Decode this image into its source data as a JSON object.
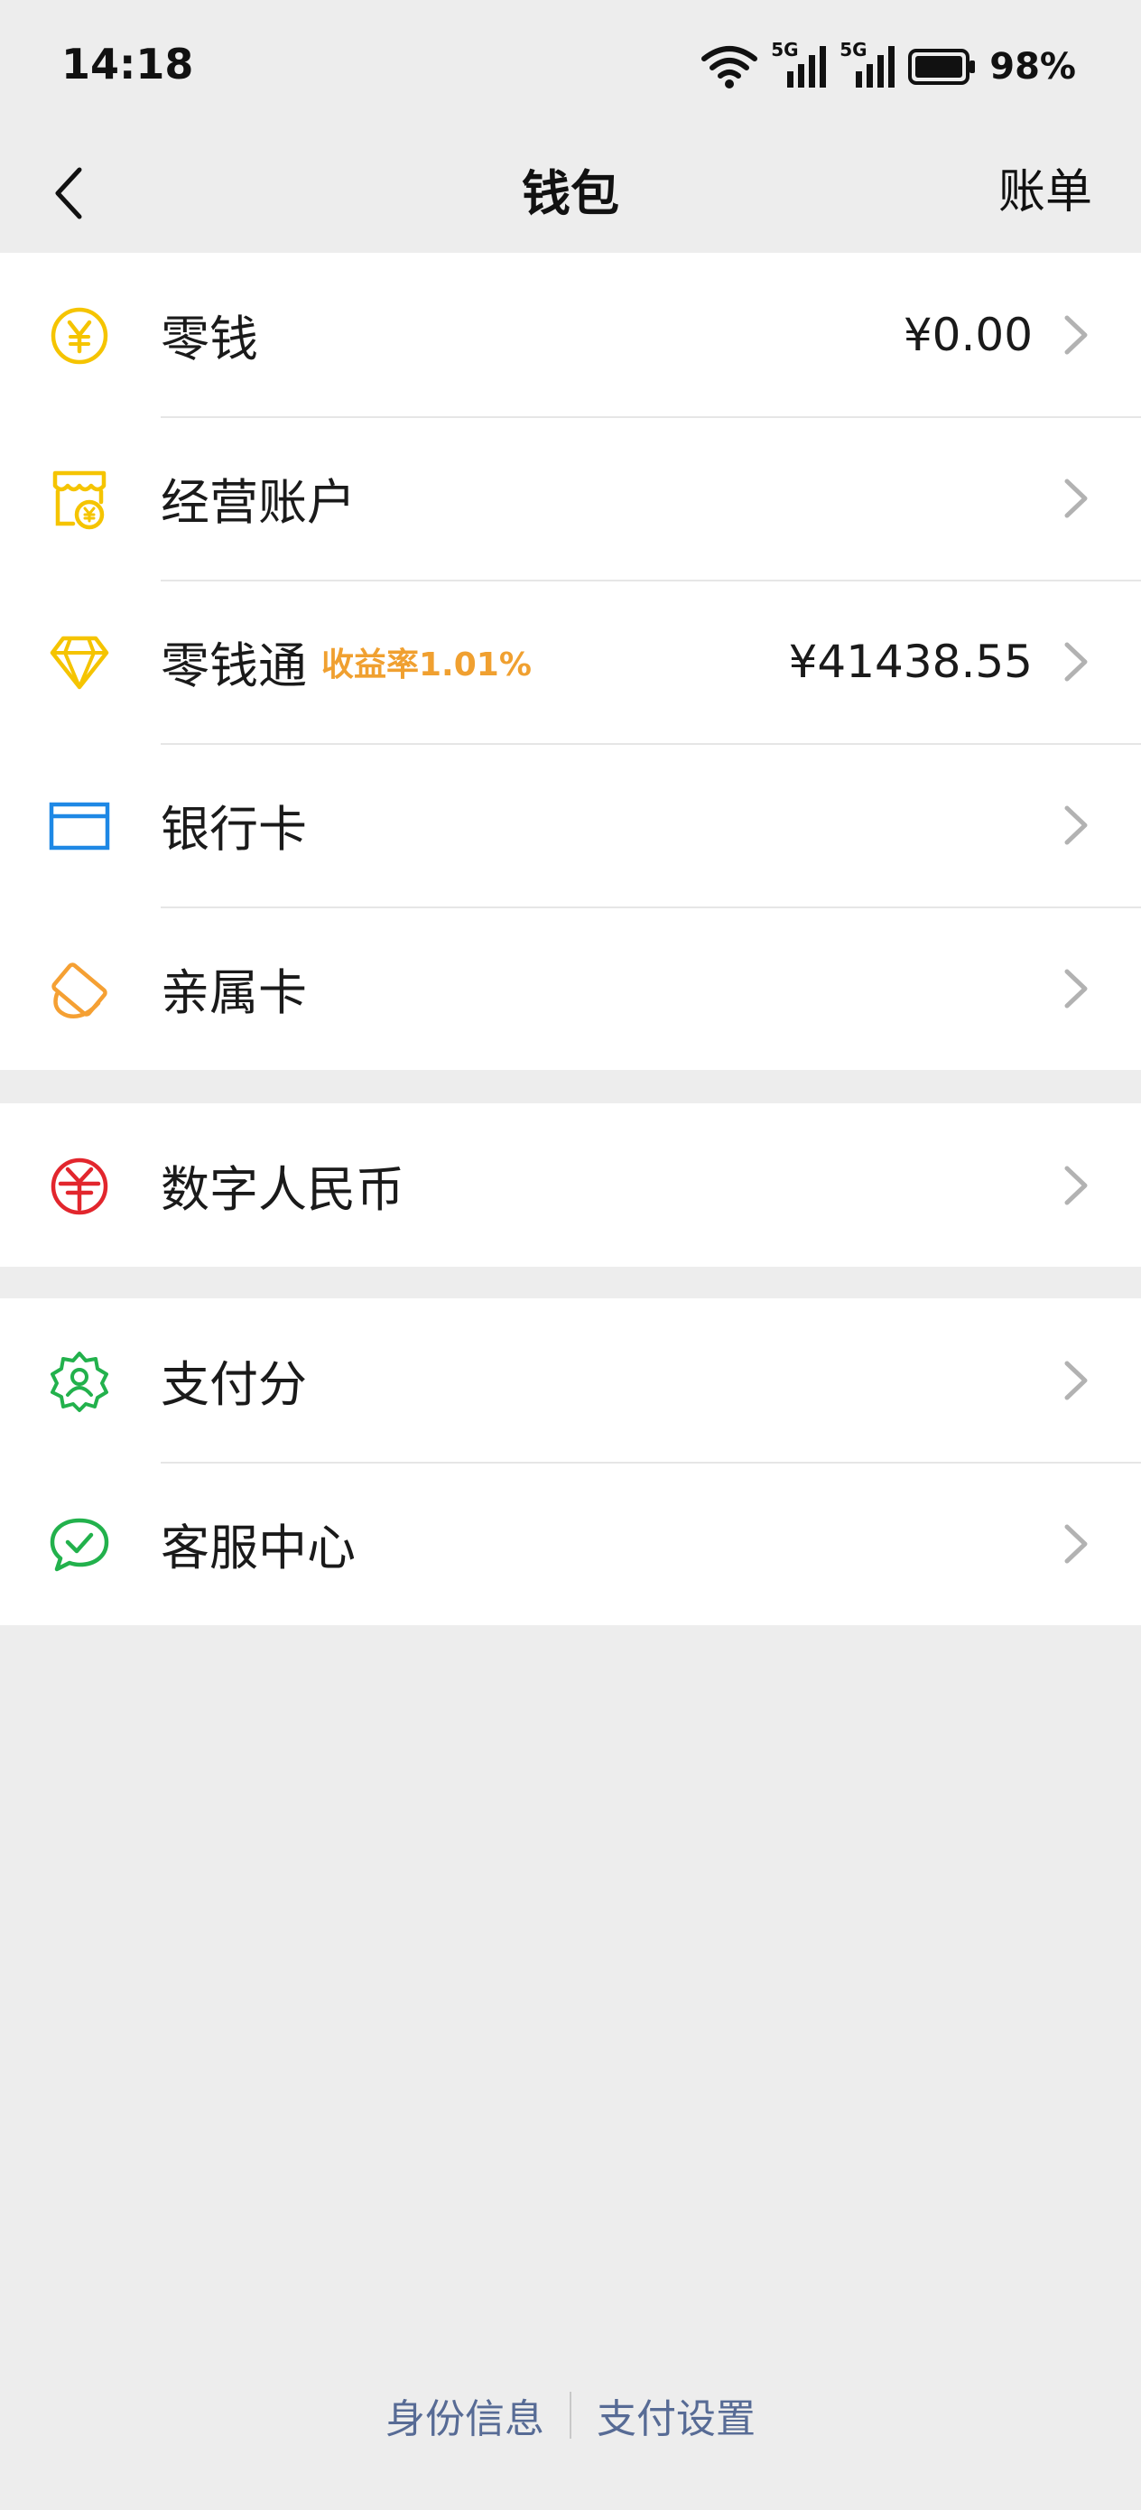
{
  "status_bar": {
    "time": "14:18",
    "network_1": "5G",
    "network_2": "5G",
    "battery": "98%"
  },
  "nav": {
    "back_icon": "chevron-left-icon",
    "title": "钱包",
    "bill_label": "账单"
  },
  "group1": [
    {
      "label": "零钱",
      "value": "¥0.00",
      "icon": "yuan-coin-icon",
      "color": "#f5c400"
    },
    {
      "label": "经营账户",
      "value": "",
      "icon": "shop-icon",
      "color": "#f5c400"
    },
    {
      "label": "零钱通",
      "badge": "收益率1.01%",
      "value": "¥41438.55",
      "icon": "diamond-icon",
      "color": "#f5c400"
    },
    {
      "label": "银行卡",
      "value": "",
      "icon": "bank-card-icon",
      "color": "#1e88e5"
    },
    {
      "label": "亲属卡",
      "value": "",
      "icon": "family-card-icon",
      "color": "#f5a033"
    }
  ],
  "group2": [
    {
      "label": "数字人民币",
      "value": "",
      "icon": "digital-rmb-icon",
      "color": "#e2262d"
    }
  ],
  "group3": [
    {
      "label": "支付分",
      "value": "",
      "icon": "pay-score-icon",
      "color": "#22b14c"
    },
    {
      "label": "客服中心",
      "value": "",
      "icon": "customer-service-icon",
      "color": "#22b14c"
    }
  ],
  "footer": {
    "identity_label": "身份信息",
    "settings_label": "支付设置",
    "link_color": "#576b95"
  }
}
